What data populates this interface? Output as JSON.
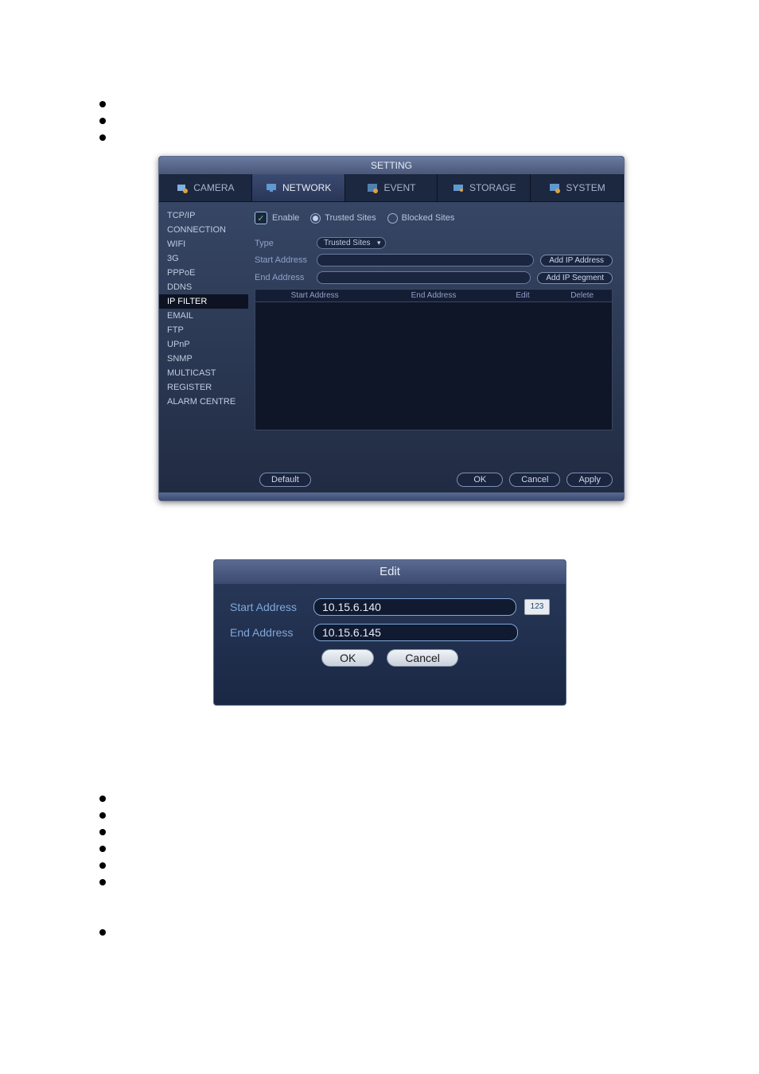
{
  "dialog1": {
    "title": "SETTING",
    "tabs": [
      {
        "label": "CAMERA"
      },
      {
        "label": "NETWORK"
      },
      {
        "label": "EVENT"
      },
      {
        "label": "STORAGE"
      },
      {
        "label": "SYSTEM"
      }
    ],
    "sidebar": [
      "TCP/IP",
      "CONNECTION",
      "WIFI",
      "3G",
      "PPPoE",
      "DDNS",
      "IP FILTER",
      "EMAIL",
      "FTP",
      "UPnP",
      "SNMP",
      "MULTICAST",
      "REGISTER",
      "ALARM CENTRE"
    ],
    "enable_label": "Enable",
    "radio_trusted": "Trusted Sites",
    "radio_blocked": "Blocked Sites",
    "type_label": "Type",
    "type_value": "Trusted Sites",
    "start_label": "Start Address",
    "end_label": "End Address",
    "add_ip_btn": "Add IP Address",
    "add_seg_btn": "Add IP Segment",
    "cols": {
      "start": "Start Address",
      "end": "End Address",
      "edit": "Edit",
      "del": "Delete"
    },
    "buttons": {
      "default": "Default",
      "ok": "OK",
      "cancel": "Cancel",
      "apply": "Apply"
    }
  },
  "dialog2": {
    "title": "Edit",
    "start_label": "Start Address",
    "end_label": "End Address",
    "start_value": "10.15.6.140",
    "end_value": "10.15.6.145",
    "kb": "123",
    "ok": "OK",
    "cancel": "Cancel"
  }
}
